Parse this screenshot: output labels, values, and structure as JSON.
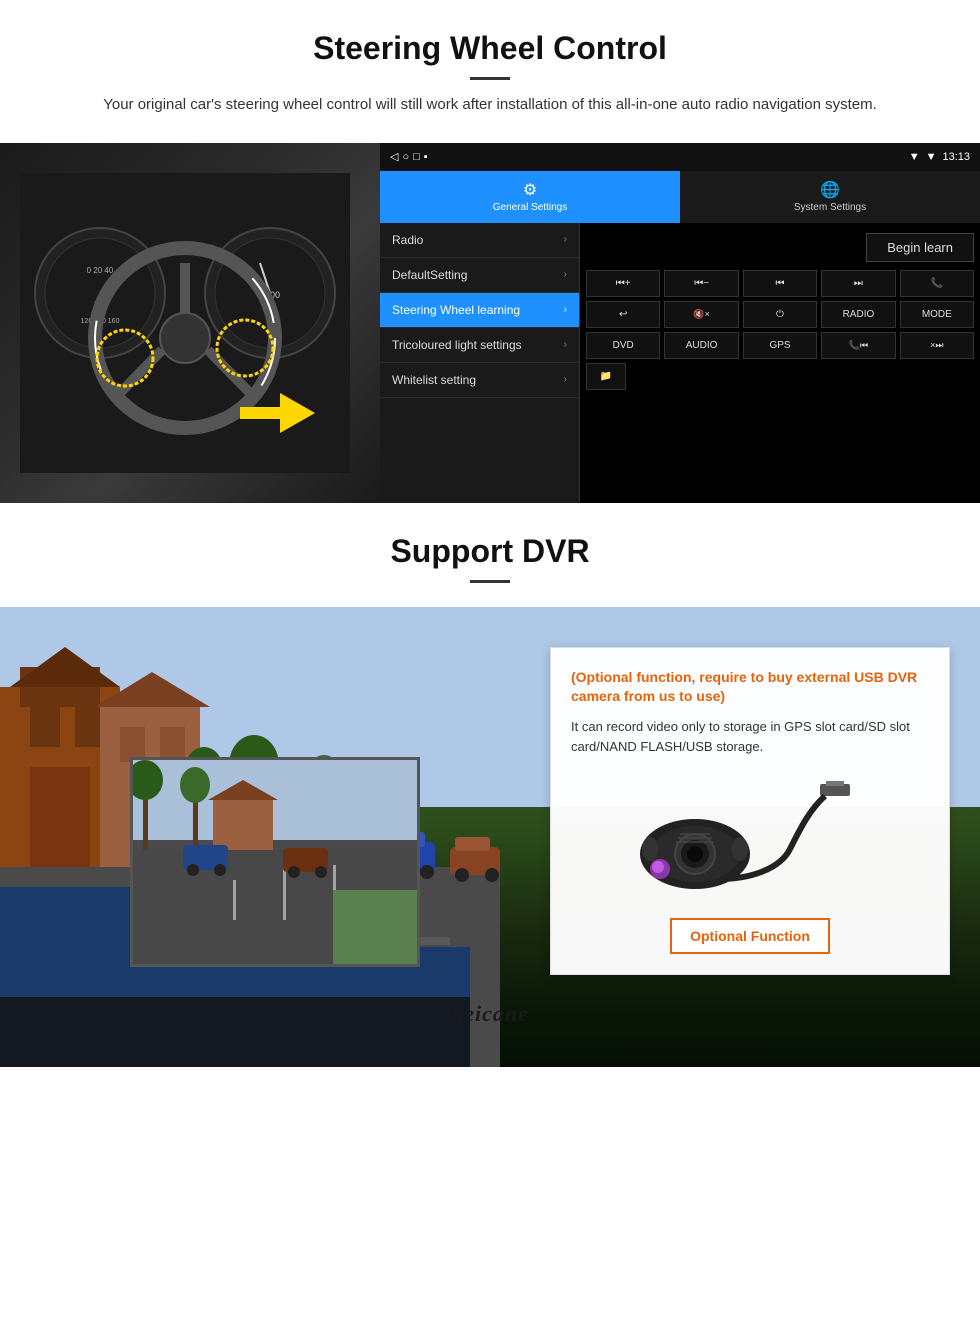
{
  "section1": {
    "title": "Steering Wheel Control",
    "description": "Your original car's steering wheel control will still work after installation of this all-in-one auto radio navigation system.",
    "status_bar": {
      "time": "13:13",
      "signal": "▼",
      "wifi": "▼"
    },
    "tabs": {
      "general": {
        "icon": "⚙",
        "label": "General Settings"
      },
      "system": {
        "icon": "🌐",
        "label": "System Settings"
      }
    },
    "menu_items": [
      {
        "label": "Radio",
        "active": false
      },
      {
        "label": "DefaultSetting",
        "active": false
      },
      {
        "label": "Steering Wheel learning",
        "active": true
      },
      {
        "label": "Tricoloured light settings",
        "active": false
      },
      {
        "label": "Whitelist setting",
        "active": false
      }
    ],
    "begin_learn_label": "Begin learn",
    "button_rows": [
      [
        "⏮+",
        "⏮−",
        "⏮",
        "⏭",
        "📞"
      ],
      [
        "↩",
        "🔇×",
        "⏻",
        "RADIO",
        "MODE"
      ],
      [
        "DVD",
        "AUDIO",
        "GPS",
        "📞⏮",
        "×⏭"
      ]
    ]
  },
  "section2": {
    "title": "Support DVR",
    "info_title": "(Optional function, require to buy external USB DVR camera from us to use)",
    "info_text": "It can record video only to storage in GPS slot card/SD slot card/NAND FLASH/USB storage.",
    "optional_function_label": "Optional Function",
    "brand": "Seicane"
  }
}
